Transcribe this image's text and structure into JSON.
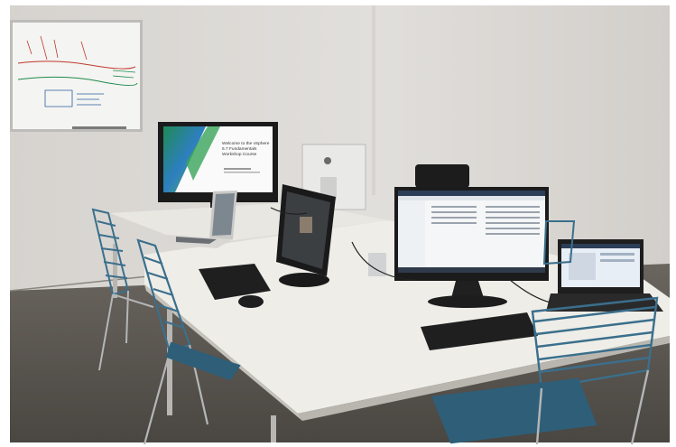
{
  "monitor_slide": {
    "title_line1": "Welcome to the vSphere",
    "title_line2": "6.7 Fundamentals",
    "title_line3": "Workshop Course"
  },
  "colors": {
    "wall": "#d9d6d2",
    "floor": "#5b5651",
    "desk": "#ecebe6",
    "chair_blue": "#3b6f8c",
    "slide_green": "#3aa55a"
  }
}
